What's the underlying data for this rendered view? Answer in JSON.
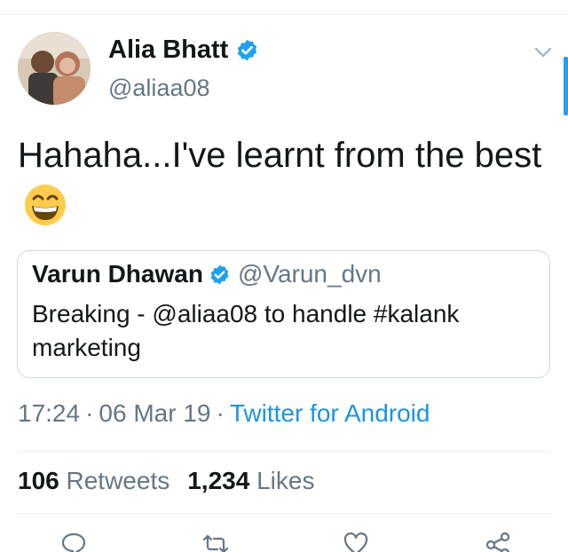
{
  "tweet": {
    "author": {
      "name": "Alia Bhatt",
      "handle": "@aliaa08",
      "verified": true
    },
    "text": "Hahaha...I've learnt from the best",
    "emoji": "grinning-face-with-smiling-eyes",
    "quoted": {
      "name": "Varun Dhawan",
      "handle": "@Varun_dvn",
      "verified": true,
      "text": "Breaking - @aliaa08 to handle #kalank marketing"
    },
    "time": "17:24",
    "date": "06 Mar 19",
    "separator": "·",
    "source": "Twitter for Android",
    "retweets_count": "106",
    "retweets_label": "Retweets",
    "likes_count": "1,234",
    "likes_label": "Likes"
  },
  "colors": {
    "accent": "#1da1f2",
    "link": "#1b95e0",
    "muted": "#657786",
    "text": "#14171a",
    "border": "#e6ecf0"
  },
  "icons": {
    "caret": "chevron-down-icon",
    "verified": "verified-badge-icon",
    "reply": "reply-icon",
    "retweet": "retweet-icon",
    "like": "heart-icon",
    "share": "share-icon"
  }
}
